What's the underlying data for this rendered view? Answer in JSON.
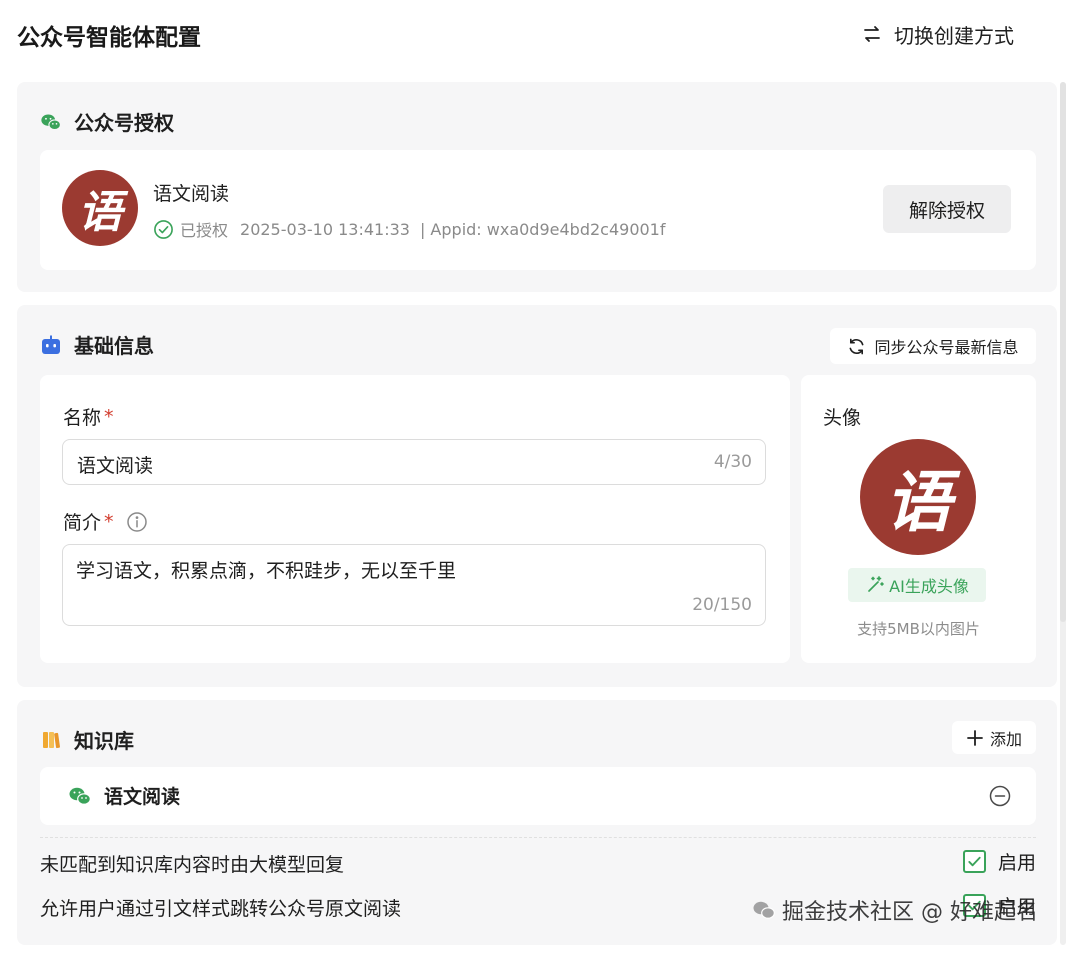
{
  "header": {
    "title": "公众号智能体配置",
    "switch_label": "切换创建方式"
  },
  "auth": {
    "section_title": "公众号授权",
    "account_name": "语文阅读",
    "avatar_glyph": "语",
    "status": "已授权",
    "authorized_at": "2025-03-10 13:41:33",
    "appid_text": "| Appid: wxa0d9e4bd2c49001f",
    "revoke_label": "解除授权"
  },
  "basic": {
    "section_title": "基础信息",
    "sync_label": "同步公众号最新信息",
    "name": {
      "label": "名称",
      "required_mark": "*",
      "value": "语文阅读",
      "counter": "4/30"
    },
    "intro": {
      "label": "简介",
      "required_mark": "*",
      "value": "学习语文，积累点滴，不积跬步，无以至千里",
      "counter": "20/150"
    },
    "avatar": {
      "label": "头像",
      "glyph": "语",
      "ai_label": "AI生成头像",
      "hint": "支持5MB以内图片"
    }
  },
  "knowledge": {
    "section_title": "知识库",
    "add_label": "添加",
    "items": [
      {
        "label": "语文阅读"
      }
    ],
    "options": [
      {
        "label": "未匹配到知识库内容时由大模型回复",
        "toggle_label": "启用",
        "checked": true
      },
      {
        "label": "允许用户通过引文样式跳转公众号原文阅读",
        "toggle_label": "启用",
        "checked": true
      }
    ]
  },
  "watermark": {
    "text": "掘金技术社区 @ 好难起名"
  },
  "colors": {
    "accent_green": "#3aa35a",
    "avatar_red": "#9b3a31",
    "required_red": "#d23c2d",
    "section_bg": "#f6f6f7"
  },
  "icons": {
    "switch": "swap-arrows-icon",
    "auth_section": "wechat-icon",
    "basic_section": "robot-icon",
    "knowledge_section": "books-icon",
    "sync": "refresh-icon",
    "add": "plus-icon",
    "remove": "minus-circle-icon",
    "status": "check-circle-icon",
    "info": "info-icon",
    "ai": "magic-wand-icon",
    "checkbox": "checkmark-icon"
  }
}
